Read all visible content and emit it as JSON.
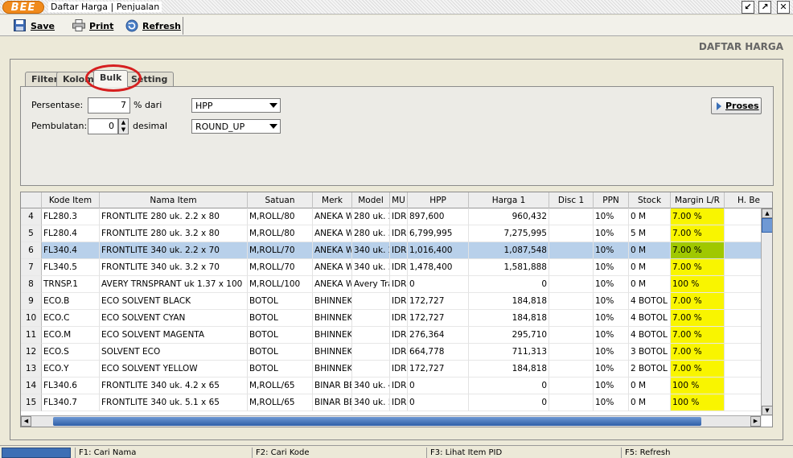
{
  "window": {
    "logo": "BEE",
    "title": "Daftar Harga | Penjualan",
    "controls": [
      "restore-icon",
      "maximize-icon",
      "close-icon"
    ]
  },
  "toolbar": {
    "save": "Save",
    "print": "Print",
    "refresh": "Refresh"
  },
  "section_title": "DAFTAR HARGA",
  "tabs": [
    "Filter",
    "Kolom",
    "Bulk",
    "Setting"
  ],
  "active_tab": "Bulk",
  "bulk": {
    "persentase_label": "Persentase:",
    "persentase_value": "7",
    "persentase_suffix": "% dari",
    "dari_value": "HPP",
    "pembulatan_label": "Pembulatan:",
    "pembulatan_value": "0",
    "pembulatan_suffix": "desimal",
    "round_value": "ROUND_UP",
    "proses_label": "Proses"
  },
  "grid": {
    "columns": [
      "Kode Item",
      "Nama Item",
      "Satuan",
      "Merk",
      "Model",
      "MU",
      "HPP",
      "Harga 1",
      "Disc 1",
      "PPN",
      "Stock",
      "Margin L/R",
      "H. Be"
    ],
    "selected_row": 2,
    "rows": [
      {
        "n": "4",
        "kode": "FL280.3",
        "nama": "FRONTLITE 280 uk. 2.2 x 80",
        "satuan": "M,ROLL/80",
        "merk": "ANEKA W",
        "model": "280 uk. 2",
        "mu": "IDR",
        "hpp": "897,600",
        "harga": "960,432",
        "disc": "",
        "ppn": "10%",
        "stock": "0 M",
        "margin": "7.00 %"
      },
      {
        "n": "5",
        "kode": "FL280.4",
        "nama": "FRONTLITE 280 uk. 3.2 x 80",
        "satuan": "M,ROLL/80",
        "merk": "ANEKA W",
        "model": "280 uk. 3",
        "mu": "IDR",
        "hpp": "6,799,995",
        "harga": "7,275,995",
        "disc": "",
        "ppn": "10%",
        "stock": "5 M",
        "margin": "7.00 %"
      },
      {
        "n": "6",
        "kode": "FL340.4",
        "nama": "FRONTLITE 340 uk. 2.2 x 70",
        "satuan": "M,ROLL/70",
        "merk": "ANEKA W",
        "model": "340 uk. 2",
        "mu": "IDR",
        "hpp": "1,016,400",
        "harga": "1,087,548",
        "disc": "",
        "ppn": "10%",
        "stock": "0 M",
        "margin": "7.00 %"
      },
      {
        "n": "7",
        "kode": "FL340.5",
        "nama": "FRONTLITE 340 uk. 3.2 x 70",
        "satuan": "M,ROLL/70",
        "merk": "ANEKA W",
        "model": "340 uk. 3",
        "mu": "IDR",
        "hpp": "1,478,400",
        "harga": "1,581,888",
        "disc": "",
        "ppn": "10%",
        "stock": "0 M",
        "margin": "7.00 %"
      },
      {
        "n": "8",
        "kode": "TRNSP.1",
        "nama": "AVERY TRNSPRANT uk 1.37 x 100",
        "satuan": "M,ROLL/100",
        "merk": "ANEKA W",
        "model": "Avery Tra",
        "mu": "IDR",
        "hpp": "0",
        "harga": "0",
        "disc": "",
        "ppn": "10%",
        "stock": "0 M",
        "margin": "100 %"
      },
      {
        "n": "9",
        "kode": "ECO.B",
        "nama": "ECO SOLVENT BLACK",
        "satuan": "BOTOL",
        "merk": "BHINNEK",
        "model": "",
        "mu": "IDR",
        "hpp": "172,727",
        "harga": "184,818",
        "disc": "",
        "ppn": "10%",
        "stock": "4 BOTOL",
        "margin": "7.00 %"
      },
      {
        "n": "10",
        "kode": "ECO.C",
        "nama": "ECO SOLVENT CYAN",
        "satuan": "BOTOL",
        "merk": "BHINNEK",
        "model": "",
        "mu": "IDR",
        "hpp": "172,727",
        "harga": "184,818",
        "disc": "",
        "ppn": "10%",
        "stock": "4 BOTOL",
        "margin": "7.00 %"
      },
      {
        "n": "11",
        "kode": "ECO.M",
        "nama": "ECO SOLVENT MAGENTA",
        "satuan": "BOTOL",
        "merk": "BHINNEK",
        "model": "",
        "mu": "IDR",
        "hpp": "276,364",
        "harga": "295,710",
        "disc": "",
        "ppn": "10%",
        "stock": "4 BOTOL",
        "margin": "7.00 %"
      },
      {
        "n": "12",
        "kode": "ECO.S",
        "nama": "SOLVENT ECO",
        "satuan": "BOTOL",
        "merk": "BHINNEK",
        "model": "",
        "mu": "IDR",
        "hpp": "664,778",
        "harga": "711,313",
        "disc": "",
        "ppn": "10%",
        "stock": "3 BOTOL",
        "margin": "7.00 %"
      },
      {
        "n": "13",
        "kode": "ECO.Y",
        "nama": "ECO SOLVENT YELLOW",
        "satuan": "BOTOL",
        "merk": "BHINNEK",
        "model": "",
        "mu": "IDR",
        "hpp": "172,727",
        "harga": "184,818",
        "disc": "",
        "ppn": "10%",
        "stock": "2 BOTOL",
        "margin": "7.00 %"
      },
      {
        "n": "14",
        "kode": "FL340.6",
        "nama": "FRONTLITE 340 uk. 4.2 x 65",
        "satuan": "M,ROLL/65",
        "merk": "BINAR BE",
        "model": "340 uk. 4",
        "mu": "IDR",
        "hpp": "0",
        "harga": "0",
        "disc": "",
        "ppn": "10%",
        "stock": "0 M",
        "margin": "100 %"
      },
      {
        "n": "15",
        "kode": "FL340.7",
        "nama": "FRONTLITE 340 uk. 5.1 x 65",
        "satuan": "M,ROLL/65",
        "merk": "BINAR BE",
        "model": "340 uk. 5",
        "mu": "IDR",
        "hpp": "0",
        "harga": "0",
        "disc": "",
        "ppn": "10%",
        "stock": "0 M",
        "margin": "100 %"
      }
    ]
  },
  "status": [
    "F1: Cari Nama",
    "F2: Cari Kode",
    "F3: Lihat Item PID",
    "F5: Refresh"
  ]
}
